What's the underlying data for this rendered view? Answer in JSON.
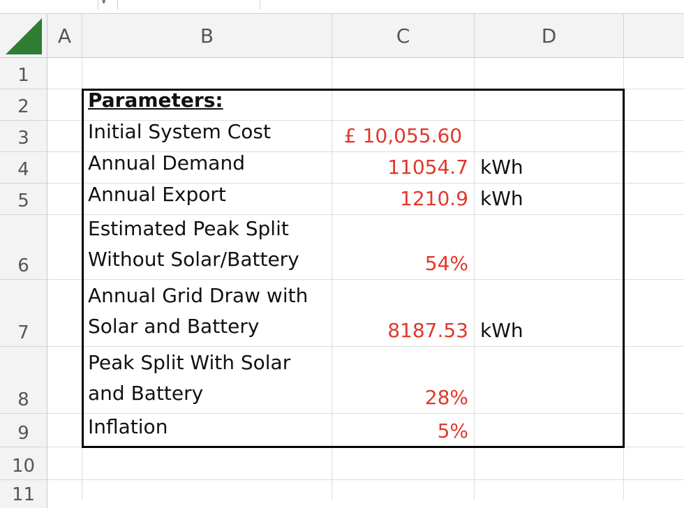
{
  "columns": [
    "A",
    "B",
    "C",
    "D"
  ],
  "rows": [
    "1",
    "2",
    "3",
    "4",
    "5",
    "6",
    "7",
    "8",
    "9",
    "10",
    "11"
  ],
  "cells": {
    "B2": "Parameters:",
    "B3": "Initial System Cost",
    "C3": "£ 10,055.60",
    "B4": "Annual Demand",
    "C4": "11054.7",
    "D4": "kWh",
    "B5": "Annual Export",
    "C5": "1210.9",
    "D5": "kWh",
    "B6_line1": "Estimated Peak Split",
    "B6_line2": "Without Solar/Battery",
    "C6": "54%",
    "B7_line1": "Annual Grid Draw with",
    "B7_line2": "Solar and Battery",
    "C7": "8187.53",
    "D7": "kWh",
    "B8_line1": "Peak Split With Solar",
    "B8_line2": "and Battery",
    "C8": "28%",
    "B9": "Inflation",
    "C9": "5%"
  },
  "colors": {
    "value_text": "#e0382b",
    "corner_triangle": "#2e7d32"
  },
  "icons": {
    "dropdown": "chevron-down-icon"
  }
}
